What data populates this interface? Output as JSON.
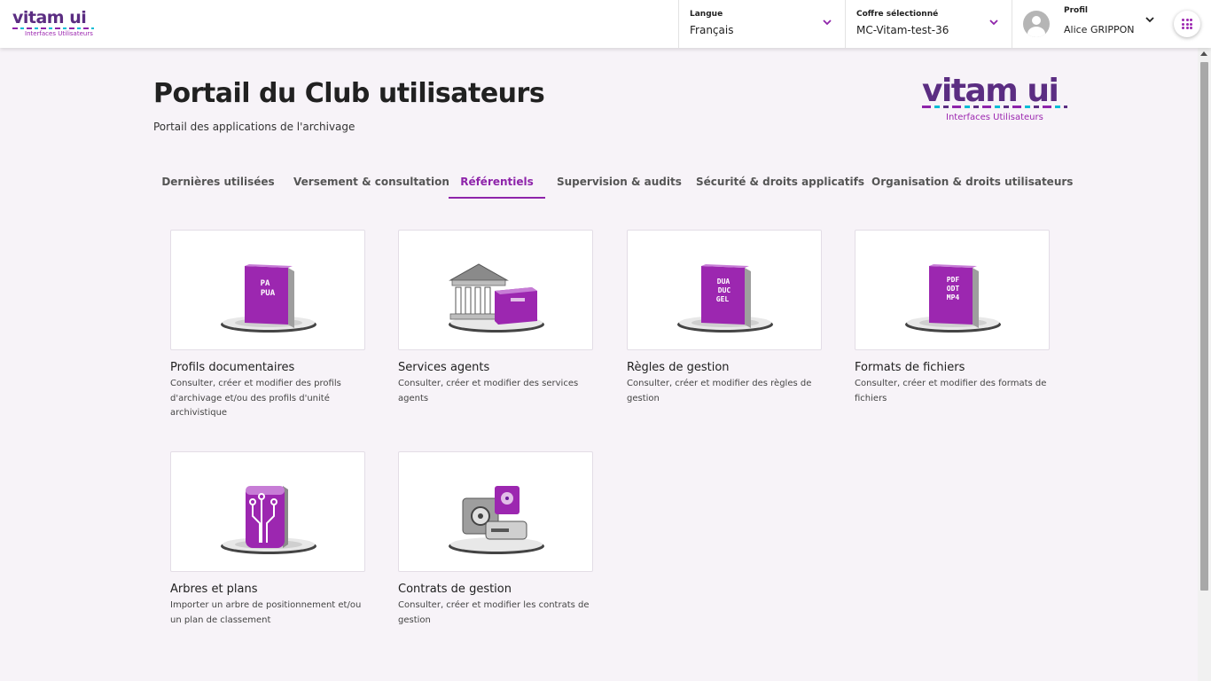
{
  "header": {
    "logo_text": "vitam ui",
    "logo_subtitle": "Interfaces Utilisateurs",
    "language": {
      "label": "Langue",
      "value": "Français"
    },
    "vault": {
      "label": "Coffre sélectionné",
      "value": "MC-Vitam-test-36"
    },
    "profile": {
      "label": "Profil",
      "value": "Alice GRIPPON"
    },
    "apps_icon": "apps-grid-icon"
  },
  "page": {
    "title": "Portail du Club utilisateurs",
    "subtitle": "Portail des applications de l'archivage",
    "logo_text": "vitam ui",
    "logo_subtitle": "Interfaces Utilisateurs"
  },
  "tabs": [
    {
      "label": "Dernières utilisées"
    },
    {
      "label": "Versement & consultation"
    },
    {
      "label": "Référentiels",
      "active": true
    },
    {
      "label": "Supervision & audits"
    },
    {
      "label": "Sécurité & droits applicatifs"
    },
    {
      "label": "Organisation & droits utilisateurs"
    }
  ],
  "colors": {
    "accent": "#8e24aa",
    "brand": "#5b2d82",
    "book": "#9c27b0"
  },
  "cards": [
    {
      "title": "Profils documentaires",
      "description": "Consulter, créer et modifier des profils d'archivage et/ou des profils d'unité archivistique",
      "icon": "profile-book-icon",
      "book_lines": [
        "PA",
        "PUA"
      ]
    },
    {
      "title": "Services agents",
      "description": "Consulter, créer et modifier des services agents",
      "icon": "institution-icon"
    },
    {
      "title": "Règles de gestion",
      "description": "Consulter, créer et modifier des règles de gestion",
      "icon": "rules-book-icon",
      "book_lines": [
        "DUA",
        "DUC",
        "GEL"
      ]
    },
    {
      "title": "Formats de fichiers",
      "description": "Consulter, créer et modifier des formats de fichiers",
      "icon": "formats-book-icon",
      "book_lines": [
        "PDF",
        "ODT",
        "MP4"
      ]
    },
    {
      "title": "Arbres et plans",
      "description": "Importer un arbre de positionnement et/ou un plan de classement",
      "icon": "tree-circuit-icon"
    },
    {
      "title": "Contrats de gestion",
      "description": "Consulter, créer et modifier les contrats de gestion",
      "icon": "safe-storage-icon"
    }
  ]
}
